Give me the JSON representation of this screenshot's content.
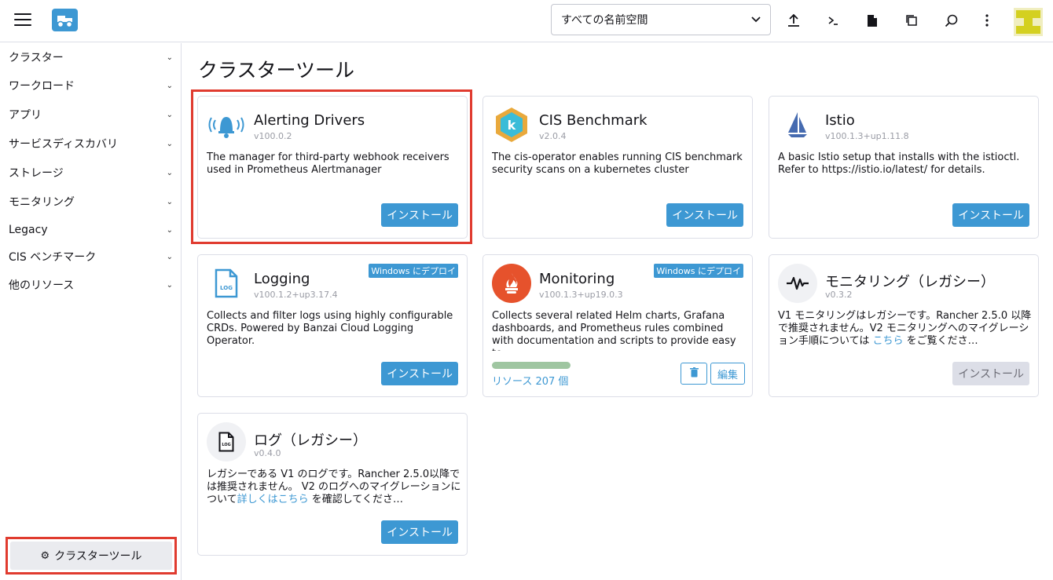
{
  "header": {
    "namespace_select": "すべての名前空間",
    "icons": [
      "upload-icon",
      "terminal-icon",
      "file-icon",
      "copy-icon",
      "search-icon",
      "more-icon"
    ]
  },
  "sidebar": {
    "items": [
      {
        "label": "クラスター"
      },
      {
        "label": "ワークロード"
      },
      {
        "label": "アプリ"
      },
      {
        "label": "サービスディスカバリ"
      },
      {
        "label": "ストレージ"
      },
      {
        "label": "モニタリング"
      },
      {
        "label": "Legacy"
      },
      {
        "label": "CIS ベンチマーク"
      },
      {
        "label": "他のリソース"
      }
    ],
    "footer_button": "クラスターツール"
  },
  "main": {
    "title": "クラスターツール",
    "cards": [
      {
        "title": "Alerting Drivers",
        "version": "v100.0.2",
        "description": "The manager for third-party webhook receivers used in Prometheus Alertmanager",
        "button": "インストール"
      },
      {
        "title": "CIS Benchmark",
        "version": "v2.0.4",
        "description": "The cis-operator enables running CIS benchmark security scans on a kubernetes cluster",
        "button": "インストール"
      },
      {
        "title": "Istio",
        "version": "v100.1.3+up1.11.8",
        "description": "A basic Istio setup that installs with the istioctl. Refer to https://istio.io/latest/ for details.",
        "button": "インストール"
      },
      {
        "title": "Logging",
        "version": "v100.1.2+up3.17.4",
        "badge": "Windows にデプロイ",
        "description": "Collects and filter logs using highly configurable CRDs. Powered by Banzai Cloud Logging Operator.",
        "button": "インストール"
      },
      {
        "title": "Monitoring",
        "version": "v100.1.3+up19.0.3",
        "badge": "Windows にデプロイ",
        "description": "Collects several related Helm charts, Grafana dashboards, and Prometheus rules combined with documentation and scripts to provide easy to…",
        "resources": "リソース 207 個",
        "edit": "編集"
      },
      {
        "title": "モニタリング（レガシー）",
        "version": "v0.3.2",
        "description_pre": "V1 モニタリングはレガシーです。Rancher 2.5.0 以降で推奨されません。V2 モニタリングへのマイグレーション手順については ",
        "link": "こちら",
        "description_post": " をご覧くださ…",
        "button": "インストール"
      },
      {
        "title": "ログ（レガシー）",
        "version": "v0.4.0",
        "description_pre": "レガシーである V1 のログです。Rancher 2.5.0以降では推奨されません。 V2 のログへのマイグレーションについて",
        "link": "詳しくはこちら",
        "description_post": " を確認してくださ…",
        "button": "インストール"
      }
    ]
  },
  "colors": {
    "accent": "#3d98d3",
    "highlight": "#e03b2f",
    "progress": "#9fc6a1"
  }
}
